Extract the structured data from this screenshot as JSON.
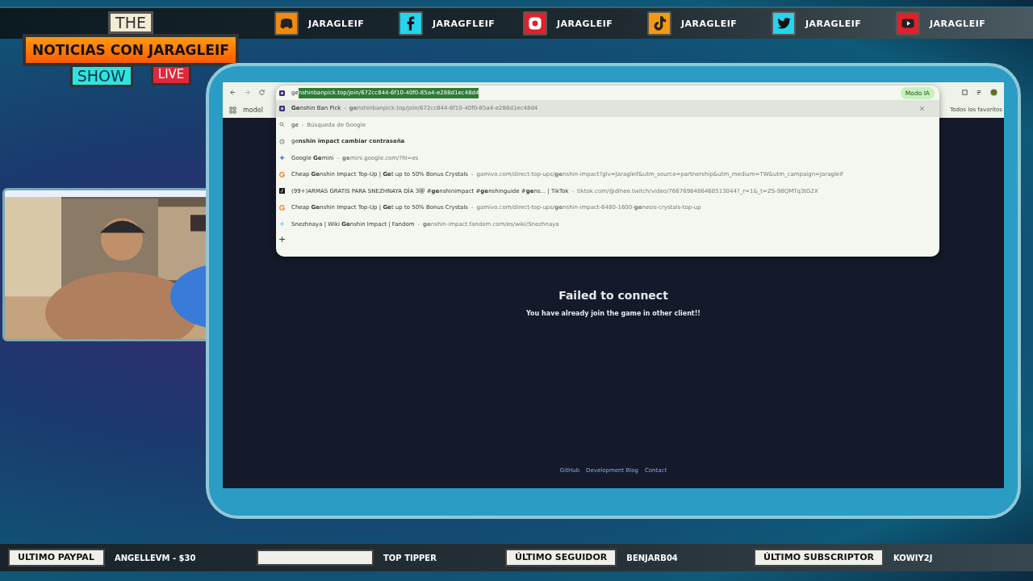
{
  "logo": {
    "top": "THE",
    "title": "NOTICIAS CON JARAGLEIF",
    "bottom": "SHOW",
    "badge": "LIVE"
  },
  "socials": [
    {
      "kind": "discord",
      "handle": "JARAGLEIF"
    },
    {
      "kind": "facebook",
      "handle": "JARAGFLEIF"
    },
    {
      "kind": "instagram",
      "handle": "JARAGLEIF"
    },
    {
      "kind": "tiktok",
      "handle": "JARAGLEIF"
    },
    {
      "kind": "twitter",
      "handle": "JARAGLEIF"
    },
    {
      "kind": "youtube",
      "handle": "JARAGLEIF"
    }
  ],
  "browser": {
    "address": {
      "typed": "ge",
      "selected": "nshinbanpick.top/join/672cc844-6f10-40f0-85a4-e288d1ec48d4"
    },
    "ai_mode": "Modo IA",
    "url_separator": "-",
    "bookmark_tab": "model",
    "bookmarks_folder": "Todos los favoritos",
    "suggestions": [
      {
        "kind": "site",
        "selected": true,
        "title": "**Ge**nshin Ban Pick",
        "url": "**ge**nshinbanpick.top/join/672cc844-6f10-40f0-85a4-e288d1ec48d4"
      },
      {
        "kind": "search",
        "selected": false,
        "title": "ge",
        "url": "Búsqueda de Google"
      },
      {
        "kind": "history",
        "selected": false,
        "title": "ge**nshin impact cambiar contraseña**"
      },
      {
        "kind": "gemini",
        "selected": false,
        "title": "Google **Ge**mini",
        "url": "**ge**mini.google.com/?hl=es"
      },
      {
        "kind": "gamivo",
        "selected": false,
        "title": "Cheap **Ge**nshin Impact Top-Up | **Ge**t up to 50% Bonus Crystals",
        "url": "gamivo.com/direct-top-ups/**ge**nshin-impact?glv=Jaragleif&utm_source=partnership&utm_medium=TW&utm_campaign=Jaragleif"
      },
      {
        "kind": "tiktok",
        "selected": false,
        "title": "(99+)ARMAS GRATIS PARA SNEZHNAYA DÍA 3😻 #**ge**nshinimpact #**ge**nshinguide #**ge**ns... | TikTok",
        "url": "tiktok.com/@dihee.twitch/video/7667698486468513044?_r=1&_t=ZS-98QMTq3tG2X"
      },
      {
        "kind": "gamivo",
        "selected": false,
        "title": "Cheap **Ge**nshin Impact Top-Up | **Ge**t up to 50% Bonus Crystals",
        "url": "gamivo.com/direct-top-ups/**ge**nshin-impact-6480-1600-**ge**nesis-crystals-top-up"
      },
      {
        "kind": "fandom",
        "selected": false,
        "title": "Snezhnaya | Wiki **Ge**nshin Impact | Fandom",
        "url": "**ge**nshin-impact.fandom.com/es/wiki/Snezhnaya"
      }
    ],
    "add_button": "+",
    "page": {
      "heading": "Failed to connect",
      "message": "You have already join the game in other client!!",
      "footer_links": [
        "GitHub",
        "Development Blog",
        "Contact"
      ]
    }
  },
  "bottom_bar": [
    {
      "label": "ULTIMO PAYPAL",
      "value": "ANGELLEVM - $30"
    },
    {
      "value": "TOP TIPPER"
    },
    {
      "label": "ÚLTIMO SEGUIDOR",
      "value": "BENJARB04"
    },
    {
      "label": "ÚLTIMO SUBSCRIPTOR",
      "value": "KOWIY2J"
    }
  ]
}
